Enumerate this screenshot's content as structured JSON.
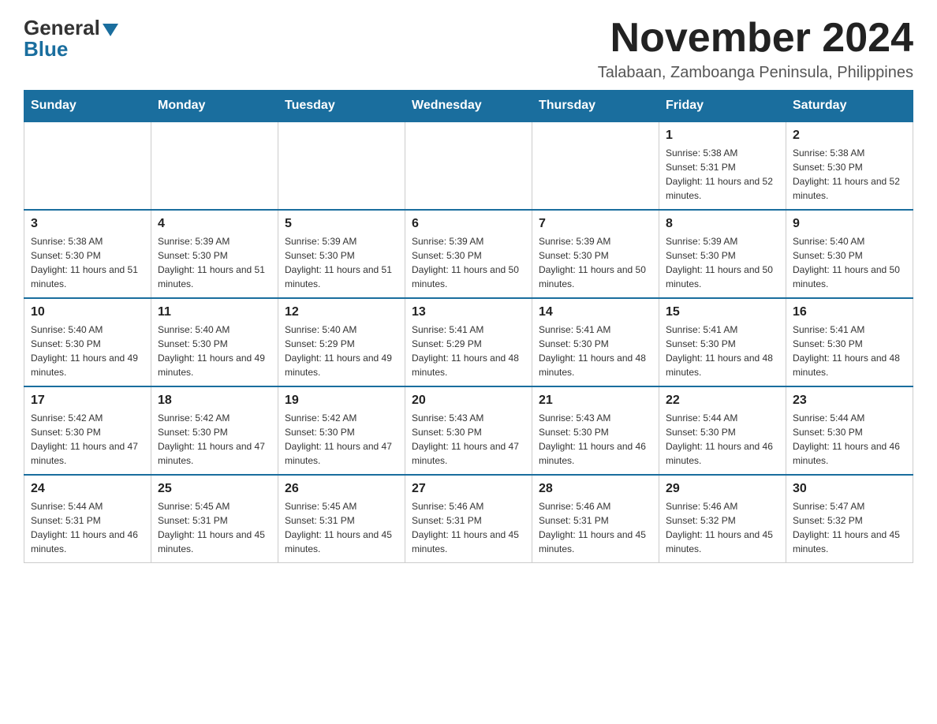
{
  "logo": {
    "general": "General",
    "blue": "Blue"
  },
  "header": {
    "month_year": "November 2024",
    "location": "Talabaan, Zamboanga Peninsula, Philippines"
  },
  "days_of_week": [
    "Sunday",
    "Monday",
    "Tuesday",
    "Wednesday",
    "Thursday",
    "Friday",
    "Saturday"
  ],
  "weeks": [
    [
      {
        "day": "",
        "info": ""
      },
      {
        "day": "",
        "info": ""
      },
      {
        "day": "",
        "info": ""
      },
      {
        "day": "",
        "info": ""
      },
      {
        "day": "",
        "info": ""
      },
      {
        "day": "1",
        "info": "Sunrise: 5:38 AM\nSunset: 5:31 PM\nDaylight: 11 hours and 52 minutes."
      },
      {
        "day": "2",
        "info": "Sunrise: 5:38 AM\nSunset: 5:30 PM\nDaylight: 11 hours and 52 minutes."
      }
    ],
    [
      {
        "day": "3",
        "info": "Sunrise: 5:38 AM\nSunset: 5:30 PM\nDaylight: 11 hours and 51 minutes."
      },
      {
        "day": "4",
        "info": "Sunrise: 5:39 AM\nSunset: 5:30 PM\nDaylight: 11 hours and 51 minutes."
      },
      {
        "day": "5",
        "info": "Sunrise: 5:39 AM\nSunset: 5:30 PM\nDaylight: 11 hours and 51 minutes."
      },
      {
        "day": "6",
        "info": "Sunrise: 5:39 AM\nSunset: 5:30 PM\nDaylight: 11 hours and 50 minutes."
      },
      {
        "day": "7",
        "info": "Sunrise: 5:39 AM\nSunset: 5:30 PM\nDaylight: 11 hours and 50 minutes."
      },
      {
        "day": "8",
        "info": "Sunrise: 5:39 AM\nSunset: 5:30 PM\nDaylight: 11 hours and 50 minutes."
      },
      {
        "day": "9",
        "info": "Sunrise: 5:40 AM\nSunset: 5:30 PM\nDaylight: 11 hours and 50 minutes."
      }
    ],
    [
      {
        "day": "10",
        "info": "Sunrise: 5:40 AM\nSunset: 5:30 PM\nDaylight: 11 hours and 49 minutes."
      },
      {
        "day": "11",
        "info": "Sunrise: 5:40 AM\nSunset: 5:30 PM\nDaylight: 11 hours and 49 minutes."
      },
      {
        "day": "12",
        "info": "Sunrise: 5:40 AM\nSunset: 5:29 PM\nDaylight: 11 hours and 49 minutes."
      },
      {
        "day": "13",
        "info": "Sunrise: 5:41 AM\nSunset: 5:29 PM\nDaylight: 11 hours and 48 minutes."
      },
      {
        "day": "14",
        "info": "Sunrise: 5:41 AM\nSunset: 5:30 PM\nDaylight: 11 hours and 48 minutes."
      },
      {
        "day": "15",
        "info": "Sunrise: 5:41 AM\nSunset: 5:30 PM\nDaylight: 11 hours and 48 minutes."
      },
      {
        "day": "16",
        "info": "Sunrise: 5:41 AM\nSunset: 5:30 PM\nDaylight: 11 hours and 48 minutes."
      }
    ],
    [
      {
        "day": "17",
        "info": "Sunrise: 5:42 AM\nSunset: 5:30 PM\nDaylight: 11 hours and 47 minutes."
      },
      {
        "day": "18",
        "info": "Sunrise: 5:42 AM\nSunset: 5:30 PM\nDaylight: 11 hours and 47 minutes."
      },
      {
        "day": "19",
        "info": "Sunrise: 5:42 AM\nSunset: 5:30 PM\nDaylight: 11 hours and 47 minutes."
      },
      {
        "day": "20",
        "info": "Sunrise: 5:43 AM\nSunset: 5:30 PM\nDaylight: 11 hours and 47 minutes."
      },
      {
        "day": "21",
        "info": "Sunrise: 5:43 AM\nSunset: 5:30 PM\nDaylight: 11 hours and 46 minutes."
      },
      {
        "day": "22",
        "info": "Sunrise: 5:44 AM\nSunset: 5:30 PM\nDaylight: 11 hours and 46 minutes."
      },
      {
        "day": "23",
        "info": "Sunrise: 5:44 AM\nSunset: 5:30 PM\nDaylight: 11 hours and 46 minutes."
      }
    ],
    [
      {
        "day": "24",
        "info": "Sunrise: 5:44 AM\nSunset: 5:31 PM\nDaylight: 11 hours and 46 minutes."
      },
      {
        "day": "25",
        "info": "Sunrise: 5:45 AM\nSunset: 5:31 PM\nDaylight: 11 hours and 45 minutes."
      },
      {
        "day": "26",
        "info": "Sunrise: 5:45 AM\nSunset: 5:31 PM\nDaylight: 11 hours and 45 minutes."
      },
      {
        "day": "27",
        "info": "Sunrise: 5:46 AM\nSunset: 5:31 PM\nDaylight: 11 hours and 45 minutes."
      },
      {
        "day": "28",
        "info": "Sunrise: 5:46 AM\nSunset: 5:31 PM\nDaylight: 11 hours and 45 minutes."
      },
      {
        "day": "29",
        "info": "Sunrise: 5:46 AM\nSunset: 5:32 PM\nDaylight: 11 hours and 45 minutes."
      },
      {
        "day": "30",
        "info": "Sunrise: 5:47 AM\nSunset: 5:32 PM\nDaylight: 11 hours and 45 minutes."
      }
    ]
  ]
}
